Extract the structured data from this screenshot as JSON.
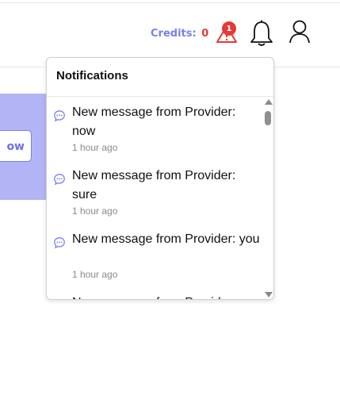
{
  "header": {
    "credits_label": "Credits:",
    "credits_value": "0",
    "alert_badge_count": "1",
    "icons": {
      "alert": "warning-triangle-icon",
      "notifications": "bell-icon",
      "profile": "user-icon"
    },
    "colors": {
      "accent": "#7b7ff0",
      "alert": "#e53935"
    }
  },
  "background": {
    "button_label": "ow"
  },
  "notifications": {
    "title": "Notifications",
    "items": [
      {
        "message": "New message from Provider: now",
        "time": "1 hour ago",
        "icon": "chat-bubble-icon"
      },
      {
        "message": "New message from Provider: sure",
        "time": "1 hour ago",
        "icon": "chat-bubble-icon"
      },
      {
        "message": "New message from Provider: you",
        "time": "1 hour ago",
        "icon": "chat-bubble-icon"
      },
      {
        "message": "New message from Provider",
        "time": "",
        "icon": "chat-bubble-icon"
      }
    ]
  }
}
